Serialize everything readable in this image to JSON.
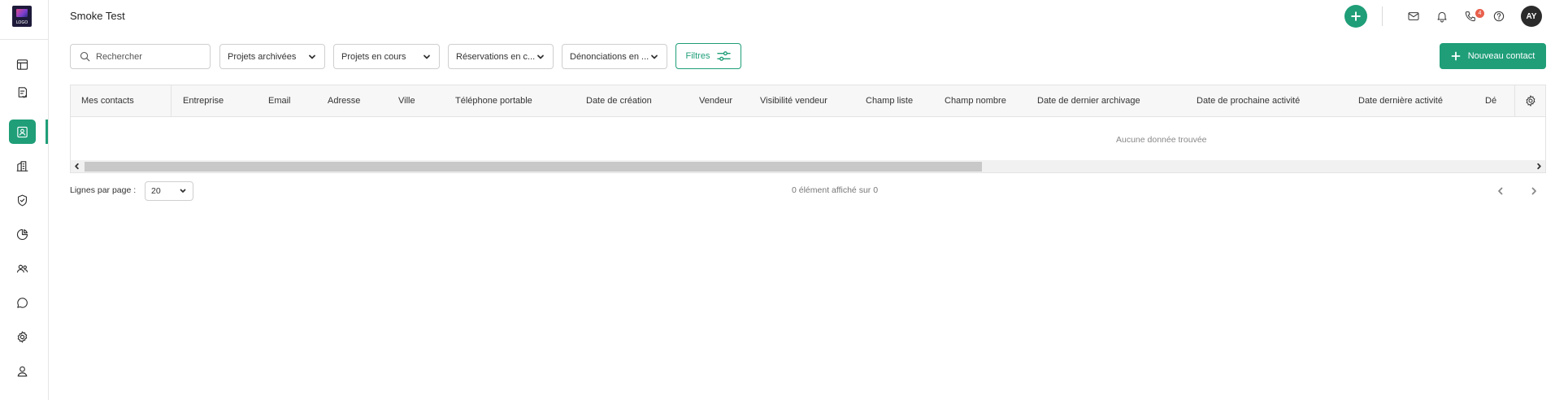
{
  "app": {
    "logo_text": "LOGO",
    "accent_color": "#1f9e78",
    "badge_color": "#e8604c"
  },
  "sidebar": {
    "items": [
      {
        "icon": "layout-icon",
        "active": false
      },
      {
        "icon": "clipboard-icon",
        "active": false
      },
      {
        "icon": "contact-card-icon",
        "active": true
      },
      {
        "icon": "buildings-icon",
        "active": false
      },
      {
        "icon": "shield-check-icon",
        "active": false
      },
      {
        "icon": "pie-chart-icon",
        "active": false
      },
      {
        "icon": "users-icon",
        "active": false
      },
      {
        "icon": "chat-bubble-icon",
        "active": false
      },
      {
        "icon": "gear-icon",
        "active": false
      },
      {
        "icon": "user-icon",
        "active": false
      }
    ]
  },
  "header": {
    "title": "Smoke Test",
    "notification_badge": "4",
    "avatar_initials": "AY"
  },
  "toolbar": {
    "search_placeholder": "Rechercher",
    "filters": [
      "Projets archivées",
      "Projets en cours",
      "Réservations en c...",
      "Dénonciations en ..."
    ],
    "filters_button": "Filtres",
    "new_contact_button": "Nouveau contact"
  },
  "table": {
    "first_column": "Mes contacts",
    "columns": [
      "Entreprise",
      "Email",
      "Adresse",
      "Ville",
      "Téléphone portable",
      "Date de création",
      "Vendeur",
      "Visibilité vendeur",
      "Champ liste",
      "Champ nombre",
      "Date de dernier archivage",
      "Date de prochaine activité",
      "Date dernière activité",
      "Dé"
    ],
    "empty_message": "Aucune donnée trouvée"
  },
  "pagination": {
    "rows_per_page_label": "Lignes par page :",
    "rows_per_page_value": "20",
    "count_text": "0 élément affiché sur 0"
  }
}
